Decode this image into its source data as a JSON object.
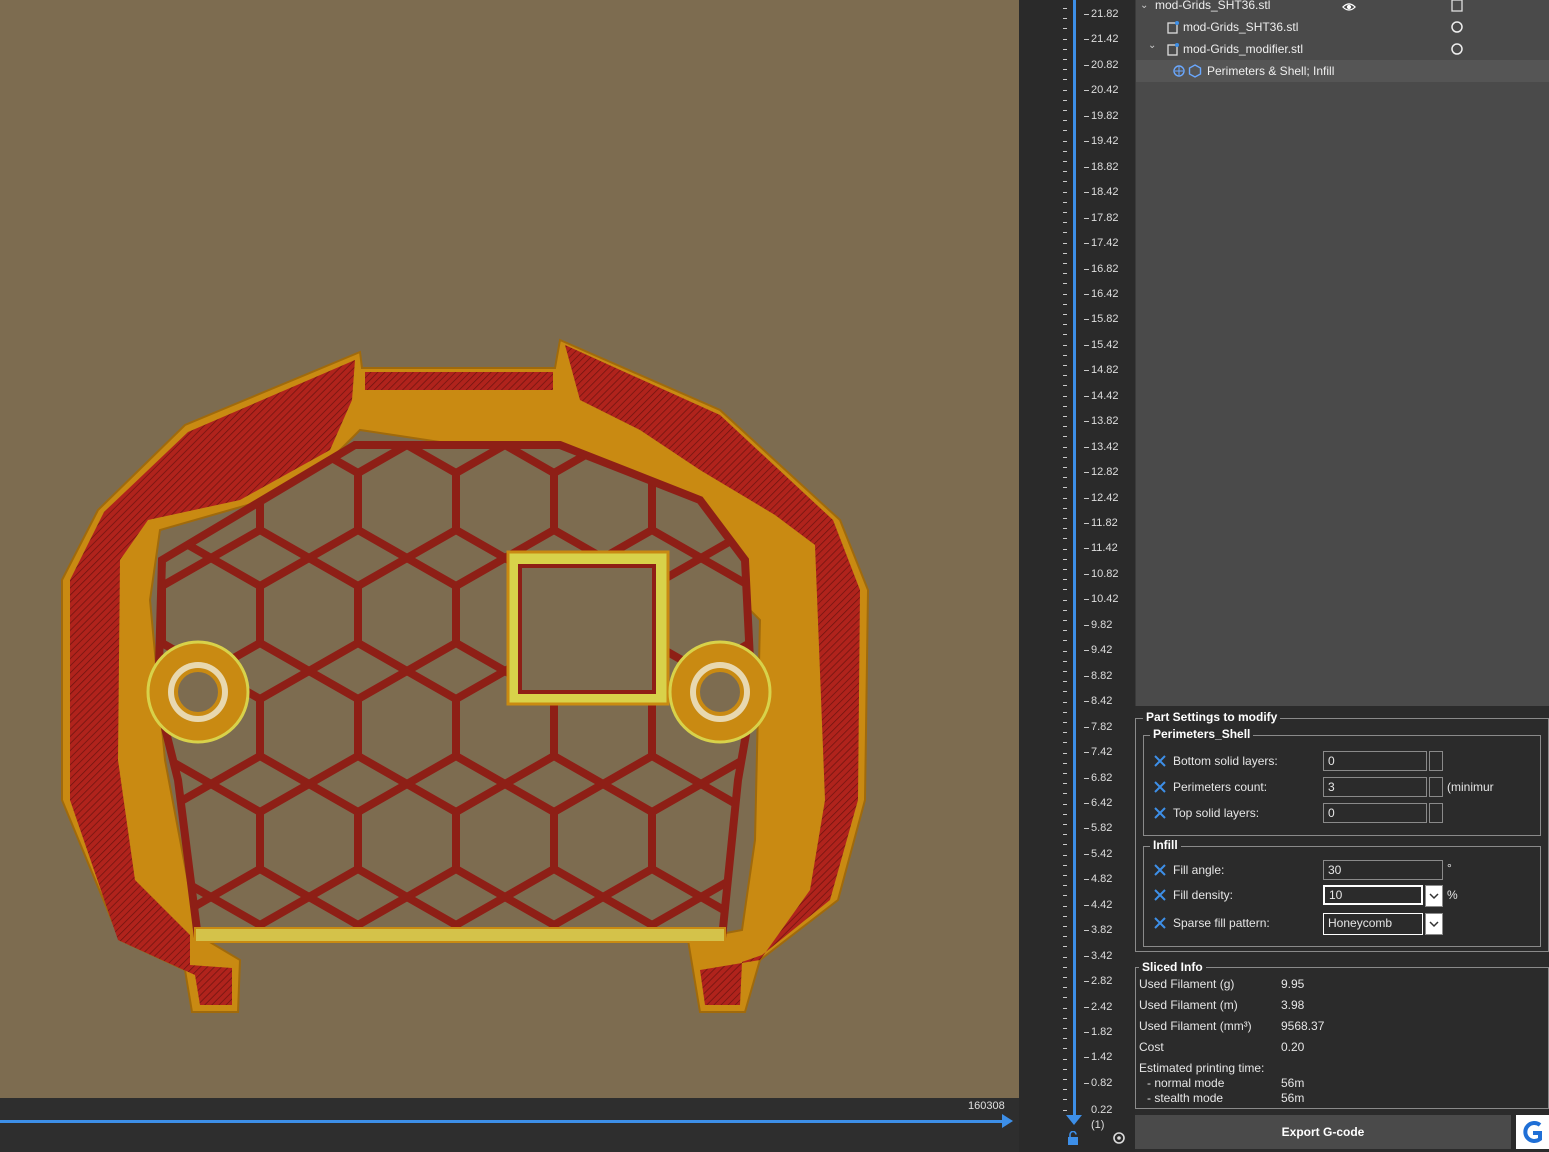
{
  "viewport": {
    "move_count": "160308"
  },
  "layer_slider": {
    "labels": [
      "21.82",
      "21.42",
      "20.82",
      "20.42",
      "19.82",
      "19.42",
      "18.82",
      "18.42",
      "17.82",
      "17.42",
      "16.82",
      "16.42",
      "15.82",
      "15.42",
      "14.82",
      "14.42",
      "13.82",
      "13.42",
      "12.82",
      "12.42",
      "11.82",
      "11.42",
      "10.82",
      "10.42",
      "9.82",
      "9.42",
      "8.82",
      "8.42",
      "7.82",
      "7.42",
      "6.82",
      "6.42",
      "5.82",
      "5.42",
      "4.82",
      "4.42",
      "3.82",
      "3.42",
      "2.82",
      "2.42",
      "1.82",
      "1.42",
      "0.82"
    ],
    "bottom_value": "0.22",
    "layer_count": "(1)"
  },
  "object_list": {
    "items": [
      {
        "label": "mod-Grids_SHT36.stl"
      },
      {
        "label": "mod-Grids_SHT36.stl"
      },
      {
        "label": "mod-Grids_modifier.stl"
      },
      {
        "label": "Perimeters & Shell; Infill"
      }
    ]
  },
  "part_settings": {
    "title": "Part Settings to modify",
    "perimeters_group": {
      "title": "Perimeters_Shell",
      "params": [
        {
          "label": "Bottom solid layers:",
          "value": "0",
          "unit": ""
        },
        {
          "label": "Perimeters count:",
          "value": "3",
          "unit": "(minimur"
        },
        {
          "label": "Top solid layers:",
          "value": "0",
          "unit": ""
        }
      ]
    },
    "infill_group": {
      "title": "Infill",
      "params": [
        {
          "label": "Fill angle:",
          "value": "30",
          "unit": "°"
        },
        {
          "label": "Fill density:",
          "value": "10",
          "unit": "%"
        },
        {
          "label": "Sparse fill pattern:",
          "value": "Honeycomb",
          "unit": ""
        }
      ]
    }
  },
  "sliced_info": {
    "title": "Sliced Info",
    "rows": [
      {
        "label": "Used Filament (g)",
        "value": "9.95"
      },
      {
        "label": "Used Filament (m)",
        "value": "3.98"
      },
      {
        "label": "Used Filament (mm³)",
        "value": "9568.37"
      },
      {
        "label": "Cost",
        "value": "0.20"
      }
    ],
    "time_title": "Estimated printing time:",
    "normal_label": "- normal mode",
    "normal_value": "56m",
    "stealth_label": "- stealth mode",
    "stealth_value": "56m"
  },
  "export_button": "Export G-code",
  "colors": {
    "accent": "#3d8fe8",
    "perimeter_red": "#a8201a",
    "shell_orange": "#c98a12",
    "bed": "#7d6c50"
  }
}
